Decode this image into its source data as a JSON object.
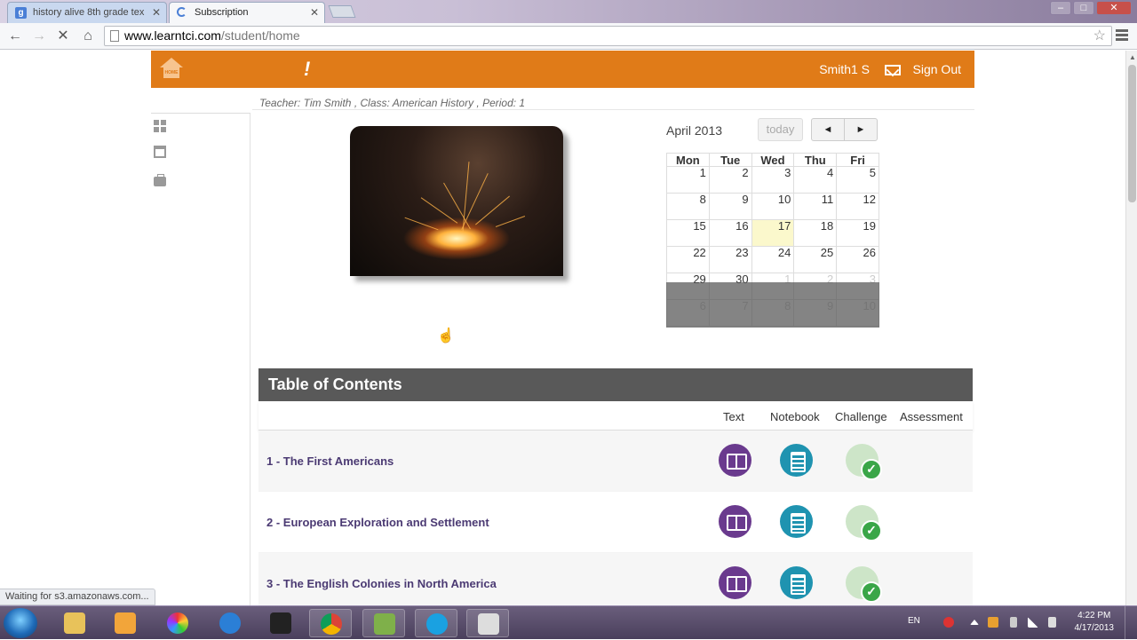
{
  "browser": {
    "tabs": [
      {
        "title": "history alive 8th grade tex",
        "favicon": "google-icon"
      },
      {
        "title": "Subscription",
        "favicon": "loading-spinner-icon",
        "active": true
      }
    ],
    "url_host": "www.learntci.com",
    "url_path": "/student/home",
    "status_text": "Waiting for s3.amazonaws.com..."
  },
  "header": {
    "home_label": "HOME",
    "logo_glyph": "!",
    "username": "Smith1 S",
    "signout_label": "Sign Out",
    "accent_color": "#e07b18"
  },
  "class_info": "Teacher: Tim Smith , Class: American History , Period: 1",
  "calendar": {
    "title": "April 2013",
    "today_label": "today",
    "prev_label": "◄",
    "next_label": "►",
    "weekdays": [
      "Mon",
      "Tue",
      "Wed",
      "Thu",
      "Fri"
    ],
    "weeks": [
      [
        "1",
        "2",
        "3",
        "4",
        "5"
      ],
      [
        "8",
        "9",
        "10",
        "11",
        "12"
      ],
      [
        "15",
        "16",
        "17",
        "18",
        "19"
      ],
      [
        "22",
        "23",
        "24",
        "25",
        "26"
      ],
      [
        "29",
        "30",
        "1",
        "2",
        "3"
      ],
      [
        "6",
        "7",
        "8",
        "9",
        "10"
      ]
    ],
    "today": "17"
  },
  "toc": {
    "title": "Table of Contents",
    "columns": [
      "Text",
      "Notebook",
      "Challenge",
      "Assessment"
    ],
    "rows": [
      {
        "title": "1 - The First Americans"
      },
      {
        "title": "2 - European Exploration and Settlement"
      },
      {
        "title": "3 - The English Colonies in North America"
      }
    ]
  },
  "taskbar": {
    "lang": "EN",
    "time": "4:22 PM",
    "date": "4/17/2013"
  }
}
